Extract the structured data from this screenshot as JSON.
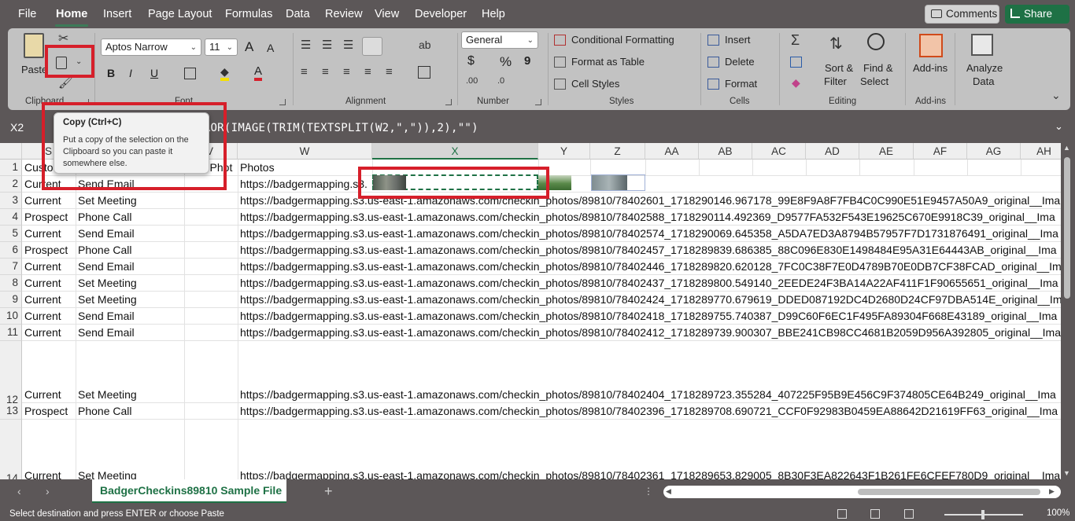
{
  "menu": {
    "items": [
      "File",
      "Home",
      "Insert",
      "Page Layout",
      "Formulas",
      "Data",
      "Review",
      "View",
      "Developer",
      "Help"
    ],
    "comments_label": "Comments",
    "share_label": "Share"
  },
  "ribbon": {
    "clipboard": {
      "paste_label": "Paste",
      "group_label": "Clipboard"
    },
    "font": {
      "font_name": "Aptos Narrow",
      "font_size": "11",
      "group_label": "Font",
      "bold": "B",
      "italic": "I",
      "underline": "U",
      "grow": "A",
      "shrink": "A",
      "font_color_glyph": "A"
    },
    "alignment": {
      "group_label": "Alignment"
    },
    "number": {
      "format": "General",
      "currency": "$",
      "percent": "%",
      "comma": "9",
      "group_label": "Number"
    },
    "styles": {
      "conditional": "Conditional Formatting",
      "format_table": "Format as Table",
      "cell_styles": "Cell Styles",
      "group_label": "Styles"
    },
    "cells": {
      "insert": "Insert",
      "delete": "Delete",
      "format": "Format",
      "group_label": "Cells"
    },
    "editing": {
      "sort_filter": "Sort &",
      "sort_filter2": "Filter",
      "find_select": "Find &",
      "find_select2": "Select",
      "group_label": "Editing"
    },
    "addins": {
      "label": "Add-ins",
      "group_label": "Add-ins"
    },
    "analyze": {
      "label1": "Analyze",
      "label2": "Data"
    }
  },
  "tooltip": {
    "title": "Copy (Ctrl+C)",
    "body": "Put a copy of the selection on the Clipboard so you can paste it somewhere else."
  },
  "formula_bar": {
    "name_box": "X2",
    "formula": "RROR(IMAGE(TRIM(TEXTSPLIT(W2,\",\")),2),\"\")"
  },
  "columns": [
    "S",
    "T",
    "V",
    "W",
    "X",
    "Y",
    "Z",
    "AA",
    "AB",
    "AC",
    "AD",
    "AE",
    "AF",
    "AG",
    "AH"
  ],
  "header_row": {
    "s": "Custo",
    "v": "r Phot",
    "w": "Photos"
  },
  "rows": [
    {
      "num": "1"
    },
    {
      "num": "2",
      "s": "Current",
      "t": "Send Email",
      "w": "https://badgermapping.s3."
    },
    {
      "num": "3",
      "s": "Current",
      "t": "Set Meeting",
      "w": "https://badgermapping.s3.us-east-1.amazonaws.com/checkin_photos/89810/78402601_1718290146.967178_99E8F9A8F7FB4C0C990E51E9457A50A9_original__Ima"
    },
    {
      "num": "4",
      "s": "Prospect",
      "t": "Phone Call",
      "w": "https://badgermapping.s3.us-east-1.amazonaws.com/checkin_photos/89810/78402588_1718290114.492369_D9577FA532F543E19625C670E9918C39_original__Ima"
    },
    {
      "num": "5",
      "s": "Current",
      "t": "Send Email",
      "w": "https://badgermapping.s3.us-east-1.amazonaws.com/checkin_photos/89810/78402574_1718290069.645358_A5DA7ED3A8794B57957F7D1731876491_original__Ima"
    },
    {
      "num": "6",
      "s": "Prospect",
      "t": "Phone Call",
      "w": "https://badgermapping.s3.us-east-1.amazonaws.com/checkin_photos/89810/78402457_1718289839.686385_88C096E830E1498484E95A31E64443AB_original__Ima"
    },
    {
      "num": "7",
      "s": "Current",
      "t": "Send Email",
      "w": "https://badgermapping.s3.us-east-1.amazonaws.com/checkin_photos/89810/78402446_1718289820.620128_7FC0C38F7E0D4789B70E0DB7CF38FCAD_original__Ima"
    },
    {
      "num": "8",
      "s": "Current",
      "t": "Set Meeting",
      "w": "https://badgermapping.s3.us-east-1.amazonaws.com/checkin_photos/89810/78402437_1718289800.549140_2EEDE24F3BA14A22AF411F1F90655651_original__Ima"
    },
    {
      "num": "9",
      "s": "Current",
      "t": "Set Meeting",
      "w": "https://badgermapping.s3.us-east-1.amazonaws.com/checkin_photos/89810/78402424_1718289770.679619_DDED087192DC4D2680D24CF97DBA514E_original__Ima"
    },
    {
      "num": "10",
      "s": "Current",
      "t": "Send Email",
      "w": "https://badgermapping.s3.us-east-1.amazonaws.com/checkin_photos/89810/78402418_1718289755.740387_D99C60F6EC1F495FA89304F668E43189_original__Ima"
    },
    {
      "num": "11",
      "s": "Current",
      "t": "Send Email",
      "w": "https://badgermapping.s3.us-east-1.amazonaws.com/checkin_photos/89810/78402412_1718289739.900307_BBE241CB98CC4681B2059D956A392805_original__Ima"
    },
    {
      "num": "12",
      "s": "Current",
      "t": "Set Meeting",
      "w": "https://badgermapping.s3.us-east-1.amazonaws.com/checkin_photos/89810/78402404_1718289723.355284_407225F95B9E456C9F374805CE64B249_original__Ima"
    },
    {
      "num": "13",
      "s": "Prospect",
      "t": "Phone Call",
      "w": "https://badgermapping.s3.us-east-1.amazonaws.com/checkin_photos/89810/78402396_1718289708.690721_CCF0F92983B0459EA88642D21619FF63_original__Ima"
    },
    {
      "num": "14",
      "s": "Current",
      "t": "Set Meeting",
      "w": "https://badgermapping.s3.us-east-1.amazonaws.com/checkin_photos/89810/78402361_1718289653.829005_8B30F3EA822643F1B261FE6CFEF780D9_original__Ima"
    }
  ],
  "sheet_tab": "BadgerCheckins89810 Sample File",
  "status": {
    "message": "Select destination and press ENTER or choose Paste",
    "zoom": "100%"
  },
  "colors": {
    "accent": "#1e7145",
    "highlight": "#d61f2a"
  }
}
